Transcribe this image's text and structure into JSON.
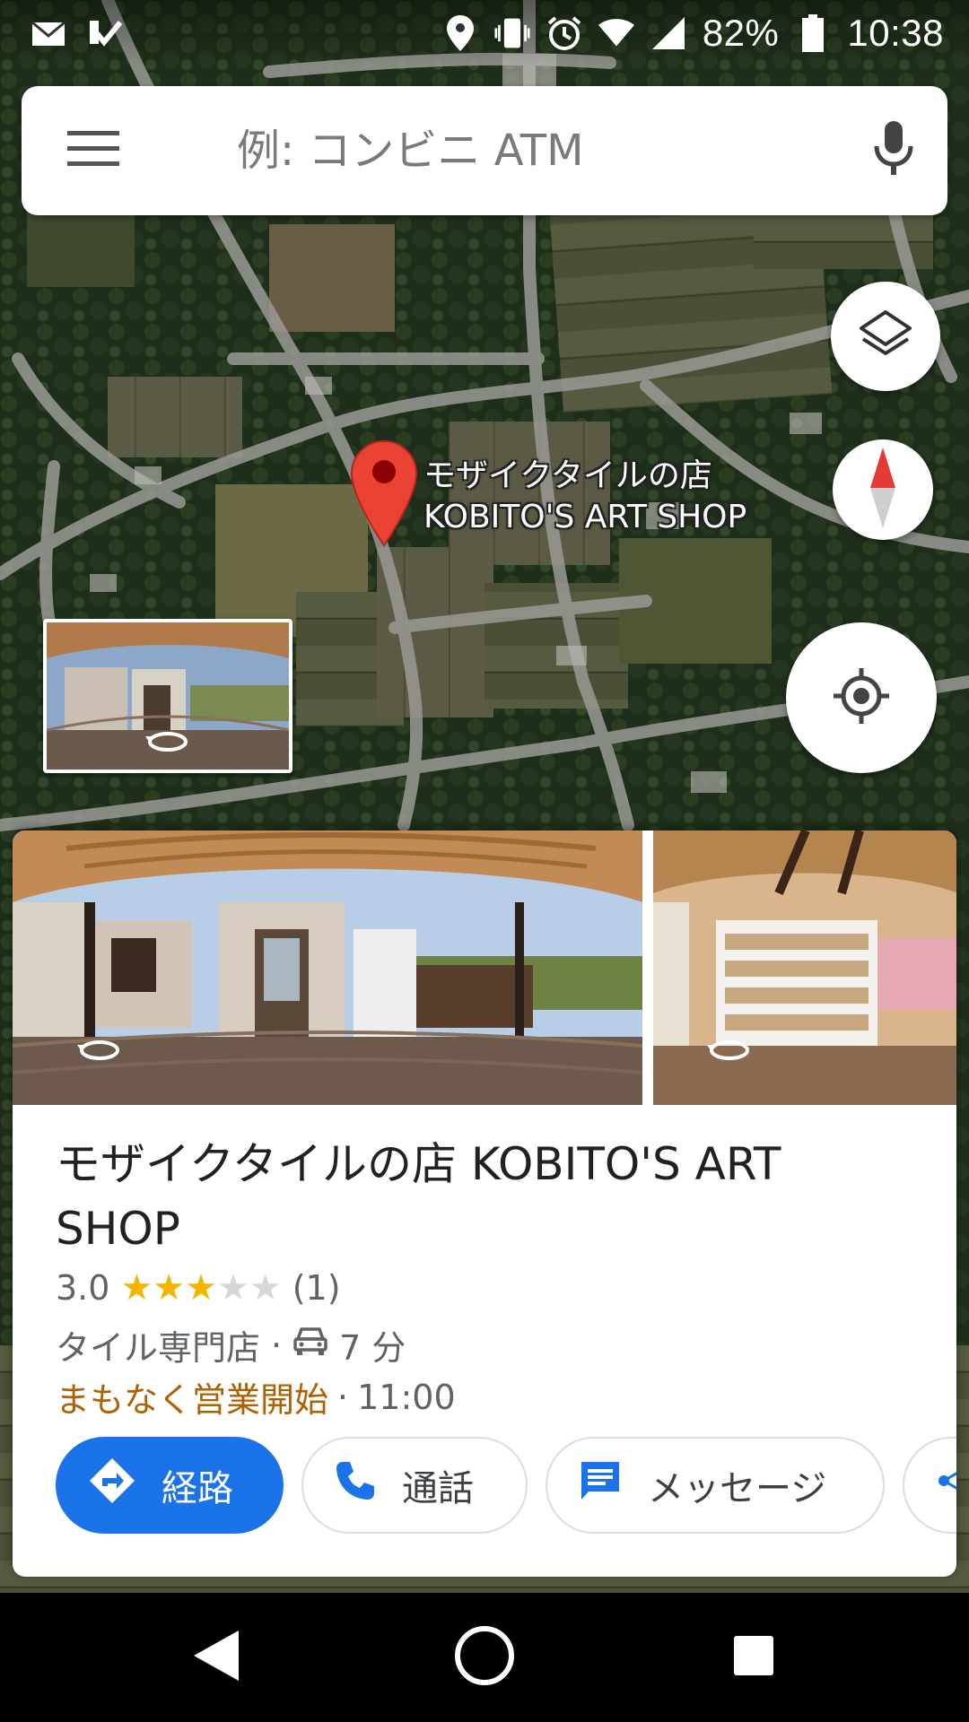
{
  "status_bar": {
    "battery_percent": "82%",
    "time": "10:38",
    "icons": [
      "mail-notification-icon",
      "task-check-icon",
      "location-icon",
      "vibrate-icon",
      "alarm-icon",
      "wifi-icon",
      "signal-icon",
      "battery-icon"
    ]
  },
  "search": {
    "placeholder": "例: コンビニ ATM",
    "menu_icon": "hamburger-menu-icon",
    "mic_icon": "microphone-icon"
  },
  "map": {
    "pin_label_line1": "モザイクタイルの店",
    "pin_label_line2": "KOBITO'S ART SHOP",
    "pin_color": "#ea4335",
    "controls": [
      "layers-icon",
      "compass-icon",
      "my-location-icon"
    ]
  },
  "place": {
    "title": "モザイクタイルの店 KOBITO'S ART SHOP",
    "rating": "3.0",
    "stars_filled": 3,
    "stars_total": 5,
    "review_count": "(1)",
    "category": "タイル専門店",
    "separator": "·",
    "drive_time": "7 分",
    "hours_status": "まもなく営業開始",
    "hours_time": "11:00",
    "hours_status_color": "#b06000"
  },
  "actions": {
    "directions": "経路",
    "call": "通話",
    "message": "メッセージ",
    "accent": "#1a73e8"
  },
  "nav": {
    "icons": [
      "back-icon",
      "home-icon",
      "recents-icon"
    ]
  }
}
